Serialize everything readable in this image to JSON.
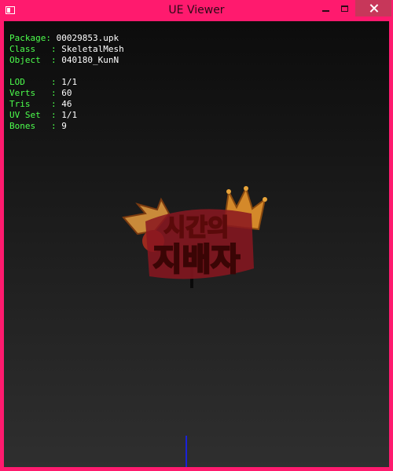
{
  "window": {
    "title": "UE Viewer"
  },
  "info": {
    "package_label": "Package",
    "package_value": "00029853.upk",
    "class_label": "Class",
    "class_value": "SkeletalMesh",
    "object_label": "Object",
    "object_value": "040180_KunN",
    "lod_label": "LOD",
    "lod_value": "1/1",
    "verts_label": "Verts",
    "verts_value": "60",
    "tris_label": "Tris",
    "tris_value": "46",
    "uvset_label": "UV Set",
    "uvset_value": "1/1",
    "bones_label": "Bones",
    "bones_value": "9"
  },
  "mesh": {
    "logo_text": "시간의 지배자"
  },
  "colors": {
    "window_border": "#ff1a6e",
    "label_green": "#4dff4d",
    "value_white": "#ffffff",
    "axis_blue": "#1a22d8"
  }
}
